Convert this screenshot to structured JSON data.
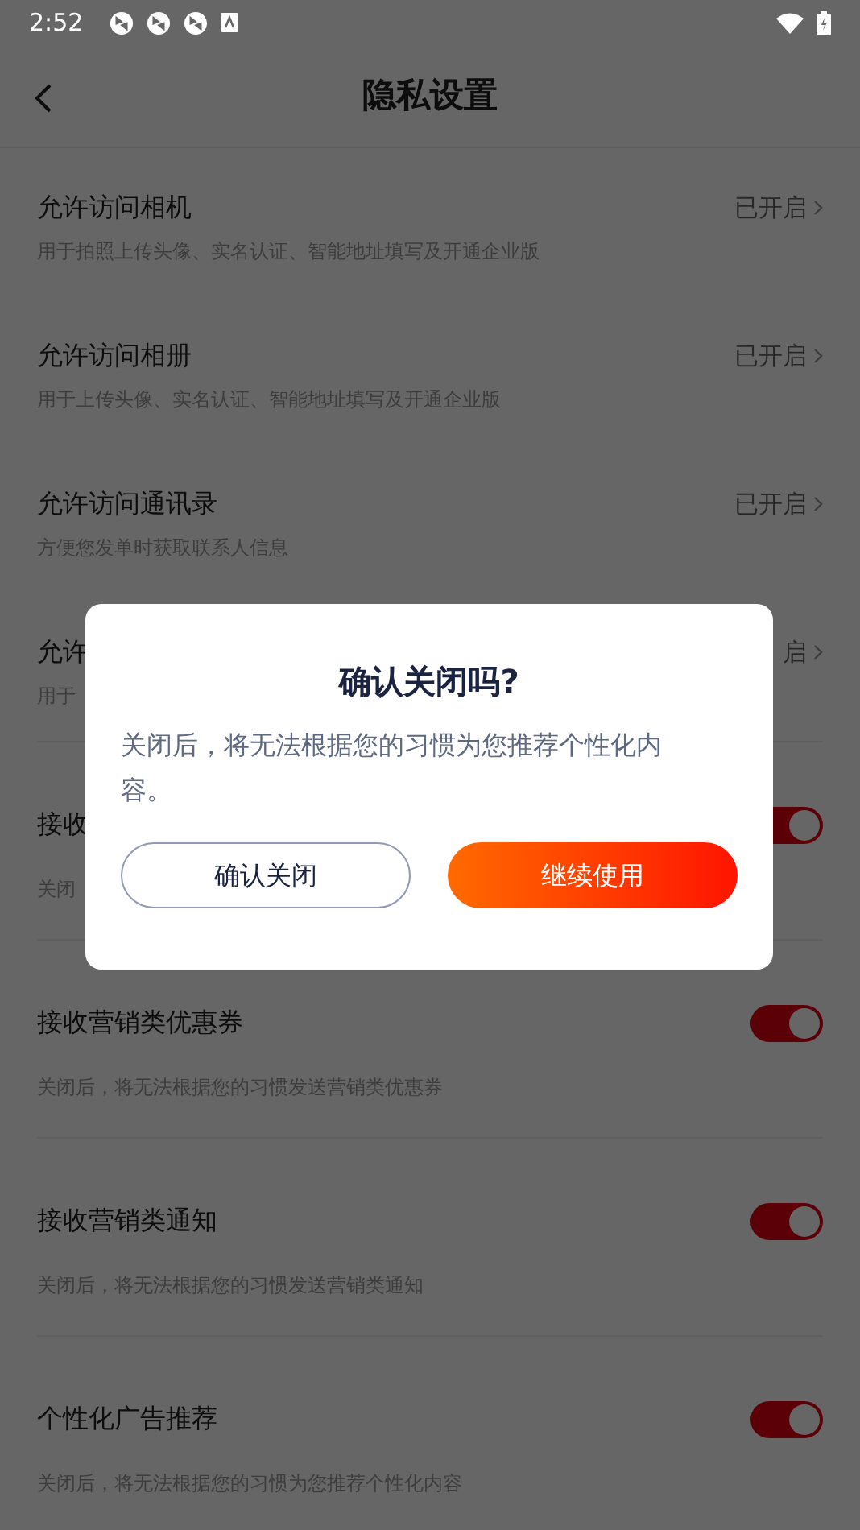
{
  "status_bar": {
    "time": "2:52"
  },
  "header": {
    "title": "隐私设置"
  },
  "settings": [
    {
      "kind": "link",
      "title": "允许访问相机",
      "subtitle": "用于拍照上传头像、实名认证、智能地址填写及开通企业版",
      "status": "已开启"
    },
    {
      "kind": "link",
      "title": "允许访问相册",
      "subtitle": "用于上传头像、实名认证、智能地址填写及开通企业版",
      "status": "已开启"
    },
    {
      "kind": "link",
      "title": "允许访问通讯录",
      "subtitle": "方便您发单时获取联系人信息",
      "status": "已开启"
    },
    {
      "kind": "link",
      "title": "允许",
      "subtitle": "用于",
      "status": "启"
    },
    {
      "kind": "toggle",
      "title": "接收",
      "subtitle": "关闭",
      "on": true
    },
    {
      "kind": "toggle",
      "title": "接收营销类优惠券",
      "subtitle": "关闭后，将无法根据您的习惯发送营销类优惠券",
      "on": true
    },
    {
      "kind": "toggle",
      "title": "接收营销类通知",
      "subtitle": "关闭后，将无法根据您的习惯发送营销类通知",
      "on": true
    },
    {
      "kind": "toggle",
      "title": "个性化广告推荐",
      "subtitle": "关闭后，将无法根据您的习惯为您推荐个性化内容",
      "on": true
    }
  ],
  "dialog": {
    "title": "确认关闭吗?",
    "message": "关闭后，将无法根据您的习惯为您推荐个性化内容。",
    "buttons": [
      {
        "kind": "secondary",
        "label": "确认关闭"
      },
      {
        "kind": "primary",
        "label": "继续使用"
      }
    ]
  }
}
